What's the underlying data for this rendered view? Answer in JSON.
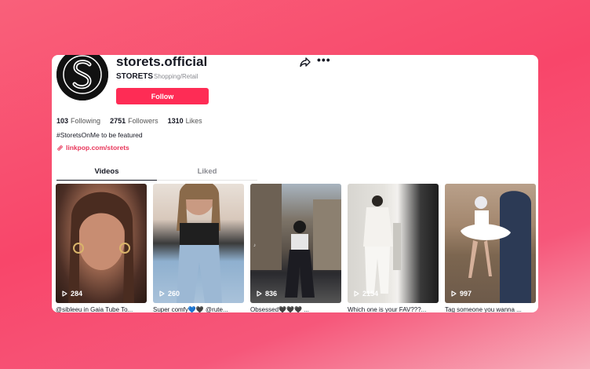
{
  "profile": {
    "username": "storets.official",
    "nickname": "STORETS",
    "category": "Shopping/Retail",
    "follow_label": "Follow",
    "bio": "#StoretsOnMe to be featured",
    "link": "linkpop.com/storets"
  },
  "stats": [
    {
      "value": "103",
      "label": "Following"
    },
    {
      "value": "2751",
      "label": "Followers"
    },
    {
      "value": "1310",
      "label": "Likes"
    }
  ],
  "tabs": [
    {
      "label": "Videos",
      "active": true
    },
    {
      "label": "Liked",
      "active": false
    }
  ],
  "videos": [
    {
      "views": "284",
      "caption": "@sibleeu in Gaia Tube To..."
    },
    {
      "views": "260",
      "caption": "Super comfy💙🖤 @rute..."
    },
    {
      "views": "836",
      "caption": "Obsessed🖤🖤🖤 ..."
    },
    {
      "views": "2154",
      "caption": "Which one is your FAV???..."
    },
    {
      "views": "997",
      "caption": "Tag someone you wanna ..."
    }
  ],
  "colors": {
    "accent": "#fe2c55",
    "background": "#f8466a"
  },
  "icons": [
    "share-icon",
    "more-icon",
    "link-icon",
    "play-icon"
  ]
}
